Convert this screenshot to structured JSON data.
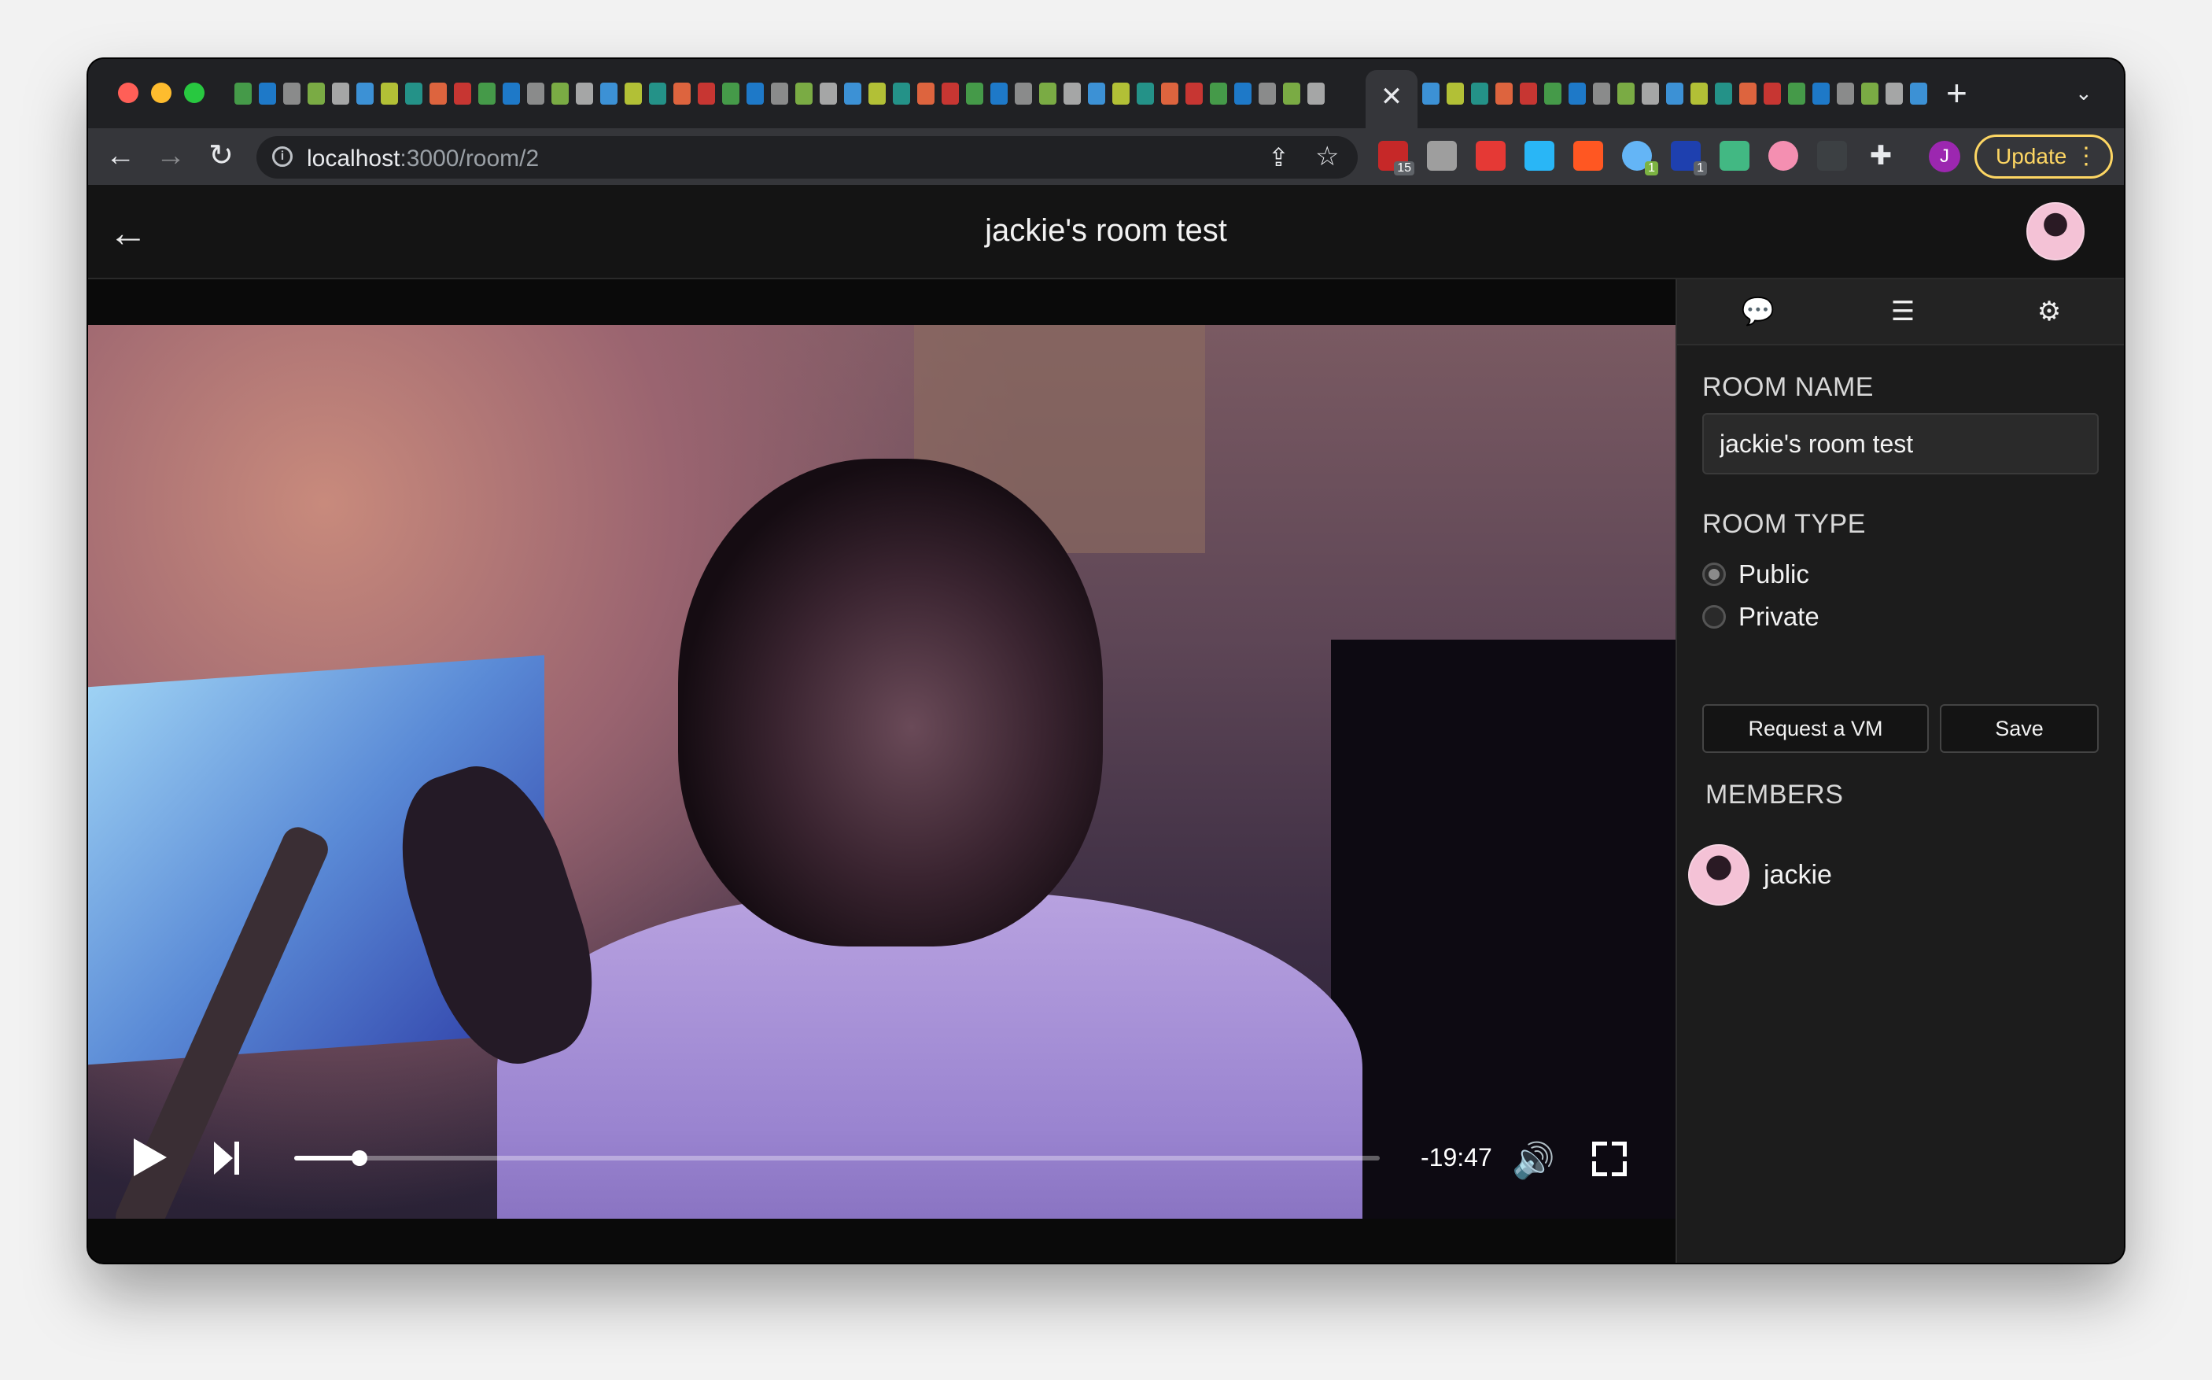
{
  "browser": {
    "address_host": "localhost",
    "address_path": ":3000/room/2",
    "update_label": "Update",
    "profile_initial": "J",
    "ext_badges": [
      "15",
      "1",
      "1"
    ],
    "info_glyph": "i",
    "icons": [
      "back-icon",
      "forward-icon",
      "reload-icon",
      "share-icon",
      "bookmark-star-icon",
      "extensions-puzzle-icon",
      "close-tab-icon",
      "new-tab-plus-icon",
      "tab-search-chevron-icon"
    ]
  },
  "app": {
    "room_title": "jackie's room test"
  },
  "video": {
    "time_remaining": "-19:47",
    "progress_fraction": 0.06,
    "icons": [
      "play-icon",
      "next-icon",
      "volume-icon",
      "fullscreen-icon"
    ]
  },
  "sidebar": {
    "tabs": [
      {
        "name": "chat",
        "icon": "chat-bubbles-icon"
      },
      {
        "name": "playlist",
        "icon": "list-icon"
      },
      {
        "name": "settings",
        "icon": "gear-icon"
      }
    ],
    "room_name_label": "ROOM NAME",
    "room_name_value": "jackie's room test",
    "room_type_label": "ROOM TYPE",
    "room_type_options": [
      "Public",
      "Private"
    ],
    "room_type_selected": "Public",
    "request_vm_label": "Request a VM",
    "save_label": "Save",
    "members_label": "MEMBERS",
    "members": [
      {
        "name": "jackie"
      }
    ]
  },
  "colors": {
    "accent_update": "#fdd663",
    "app_bg": "#1a1a1a",
    "sidebar_bg": "#1c1c1c"
  }
}
